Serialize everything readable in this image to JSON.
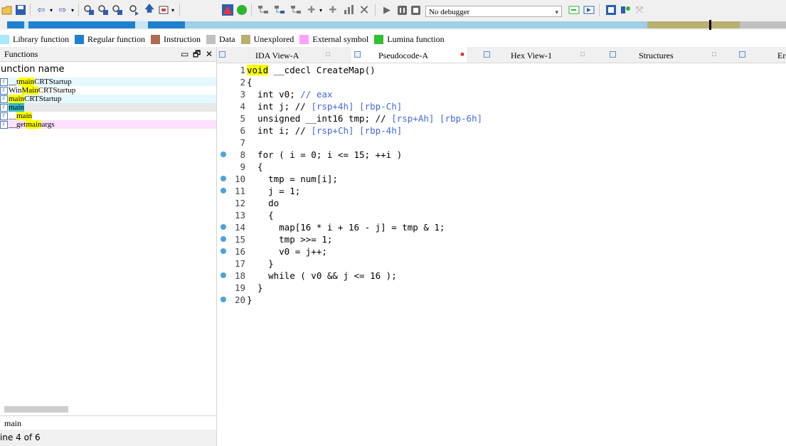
{
  "toolbar": {
    "debugger_value": "No debugger"
  },
  "legend": [
    {
      "label": "Library function",
      "color": "#a8e8ff"
    },
    {
      "label": "Regular function",
      "color": "#2080d0"
    },
    {
      "label": "Instruction",
      "color": "#b06a50"
    },
    {
      "label": "Data",
      "color": "#c0c0c0"
    },
    {
      "label": "Unexplored",
      "color": "#b8b070"
    },
    {
      "label": "External symbol",
      "color": "#ffa0ff"
    },
    {
      "label": "Lumina function",
      "color": "#30c030"
    }
  ],
  "functions_panel": {
    "title": "Functions",
    "column_header": "unction name",
    "items": [
      {
        "prefix": "__t",
        "match": "main",
        "suffix": "CRTStartup",
        "bg": "#e4f8ff"
      },
      {
        "prefix": "Win",
        "match": "Main",
        "suffix": "CRTStartup",
        "bg": "#ffffff"
      },
      {
        "prefix": "",
        "match": "main",
        "suffix": "CRTStartup",
        "bg": "#e4f8ff"
      },
      {
        "prefix": "",
        "match": "main",
        "suffix": "",
        "bg": "#e8e8e8"
      },
      {
        "prefix": "__",
        "match": "main",
        "suffix": "",
        "bg": "#ffffff"
      },
      {
        "prefix": "__get",
        "match": "main",
        "suffix": "args",
        "bg": "#ffe0ff"
      }
    ],
    "search_text": "main",
    "status": "ine 4 of 6"
  },
  "tabs": [
    {
      "label": "IDA View-A",
      "active": false
    },
    {
      "label": "Pseudocode-A",
      "active": true
    },
    {
      "label": "Hex View-1",
      "active": false
    },
    {
      "label": "Structures",
      "active": false
    },
    {
      "label": "Er",
      "active": false
    }
  ],
  "code": {
    "header_keyword": "void",
    "header_rest": " __cdecl CreateMap()",
    "lines": [
      {
        "n": "1",
        "bp": false
      },
      {
        "n": "2",
        "bp": false,
        "text": "{"
      },
      {
        "n": "3",
        "bp": false,
        "text": "  int v0; ",
        "comment": "// eax"
      },
      {
        "n": "4",
        "bp": false,
        "text": "  int j; // ",
        "comment": "[rsp+4h] [rbp-Ch]"
      },
      {
        "n": "5",
        "bp": false,
        "text": "  unsigned __int16 tmp; // ",
        "comment": "[rsp+Ah] [rbp-6h]"
      },
      {
        "n": "6",
        "bp": false,
        "text": "  int i; // ",
        "comment": "[rsp+Ch] [rbp-4h]"
      },
      {
        "n": "7",
        "bp": false,
        "text": ""
      },
      {
        "n": "8",
        "bp": true,
        "text": "  for ( i = 0; i <= 15; ++i )"
      },
      {
        "n": "9",
        "bp": false,
        "text": "  {"
      },
      {
        "n": "10",
        "bp": true,
        "text": "    tmp = num[i];"
      },
      {
        "n": "11",
        "bp": true,
        "text": "    j = 1;"
      },
      {
        "n": "12",
        "bp": false,
        "text": "    do"
      },
      {
        "n": "13",
        "bp": false,
        "text": "    {"
      },
      {
        "n": "14",
        "bp": true,
        "text": "      map[16 * i + 16 - j] = tmp & 1;"
      },
      {
        "n": "15",
        "bp": true,
        "text": "      tmp >>= 1;"
      },
      {
        "n": "16",
        "bp": true,
        "text": "      v0 = j++;"
      },
      {
        "n": "17",
        "bp": false,
        "text": "    }"
      },
      {
        "n": "18",
        "bp": true,
        "text": "    while ( v0 && j <= 16 );"
      },
      {
        "n": "19",
        "bp": false,
        "text": "  }"
      },
      {
        "n": "20",
        "bp": true,
        "text": "}"
      }
    ]
  }
}
